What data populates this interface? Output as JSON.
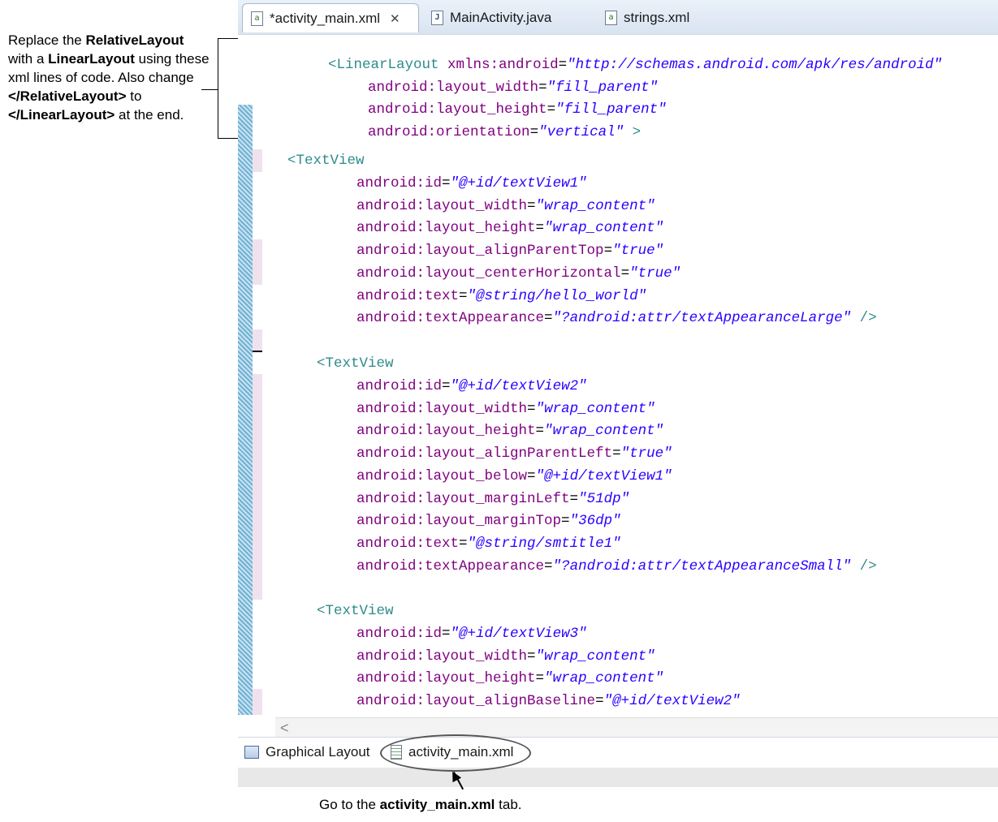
{
  "annotations": {
    "left_note": {
      "p1": "Replace the ",
      "b1": "RelativeLayout",
      "p2": " with a ",
      "b2": "LinearLayout",
      "p3": " using these xml lines of code. Also change ",
      "b3": "</RelativeLayout>",
      "p4": " to ",
      "b4": "</LinearLayout>",
      "p5": " at the end."
    },
    "bottom_note": {
      "p1": "Go to the ",
      "b1": "activity_main.xml",
      "p2": " tab."
    }
  },
  "editor_tabs": [
    {
      "label": "*activity_main.xml",
      "icon": "xml-file-icon",
      "active": true,
      "close": "✕"
    },
    {
      "label": "MainActivity.java",
      "icon": "java-file-icon",
      "active": false
    },
    {
      "label": "strings.xml",
      "icon": "xml-file-icon",
      "active": false
    }
  ],
  "code": {
    "l1": {
      "tag": "<LinearLayout",
      "attr": " xmlns:android",
      "eq": "=",
      "val": "\"http://schemas.android.com/apk/res/android\""
    },
    "l2": {
      "attr": "android:layout_width",
      "eq": "=",
      "val": "\"fill_parent\""
    },
    "l3": {
      "attr": "android:layout_height",
      "eq": "=",
      "val": "\"fill_parent\""
    },
    "l4": {
      "attr": "android:orientation",
      "eq": "=",
      "val": "\"vertical\"",
      "end": " >"
    },
    "tv1": {
      "tag": "<TextView",
      "lines": [
        {
          "attr": "android:id",
          "val": "\"@+id/textView1\""
        },
        {
          "attr": "android:layout_width",
          "val": "\"wrap_content\""
        },
        {
          "attr": "android:layout_height",
          "val": "\"wrap_content\""
        },
        {
          "attr": "android:layout_alignParentTop",
          "val": "\"true\""
        },
        {
          "attr": "android:layout_centerHorizontal",
          "val": "\"true\""
        },
        {
          "attr": "android:text",
          "val": "\"@string/hello_world\""
        },
        {
          "attr": "android:textAppearance",
          "val": "\"?android:attr/textAppearanceLarge\"",
          "end": " />"
        }
      ]
    },
    "tv2": {
      "tag": "<TextView",
      "lines": [
        {
          "attr": "android:id",
          "val": "\"@+id/textView2\""
        },
        {
          "attr": "android:layout_width",
          "val": "\"wrap_content\""
        },
        {
          "attr": "android:layout_height",
          "val": "\"wrap_content\""
        },
        {
          "attr": "android:layout_alignParentLeft",
          "val": "\"true\""
        },
        {
          "attr": "android:layout_below",
          "val": "\"@+id/textView1\""
        },
        {
          "attr": "android:layout_marginLeft",
          "val": "\"51dp\""
        },
        {
          "attr": "android:layout_marginTop",
          "val": "\"36dp\""
        },
        {
          "attr": "android:text",
          "val": "\"@string/smtitle1\""
        },
        {
          "attr": "android:textAppearance",
          "val": "\"?android:attr/textAppearanceSmall\"",
          "end": " />"
        }
      ]
    },
    "tv3": {
      "tag": "<TextView",
      "lines": [
        {
          "attr": "android:id",
          "val": "\"@+id/textView3\""
        },
        {
          "attr": "android:layout_width",
          "val": "\"wrap_content\""
        },
        {
          "attr": "android:layout_height",
          "val": "\"wrap_content\""
        },
        {
          "attr": "android:layout_alignBaseline",
          "val": "\"@+id/textView2\""
        }
      ]
    }
  },
  "scroll_arrow": "<",
  "bottom_tabs": [
    {
      "label": "Graphical Layout",
      "icon": "layout-icon"
    },
    {
      "label": "activity_main.xml",
      "icon": "xml-source-icon"
    }
  ],
  "colors": {
    "tag": "#2e8b8b",
    "attribute": "#7f007f",
    "value": "#2a00ff"
  }
}
